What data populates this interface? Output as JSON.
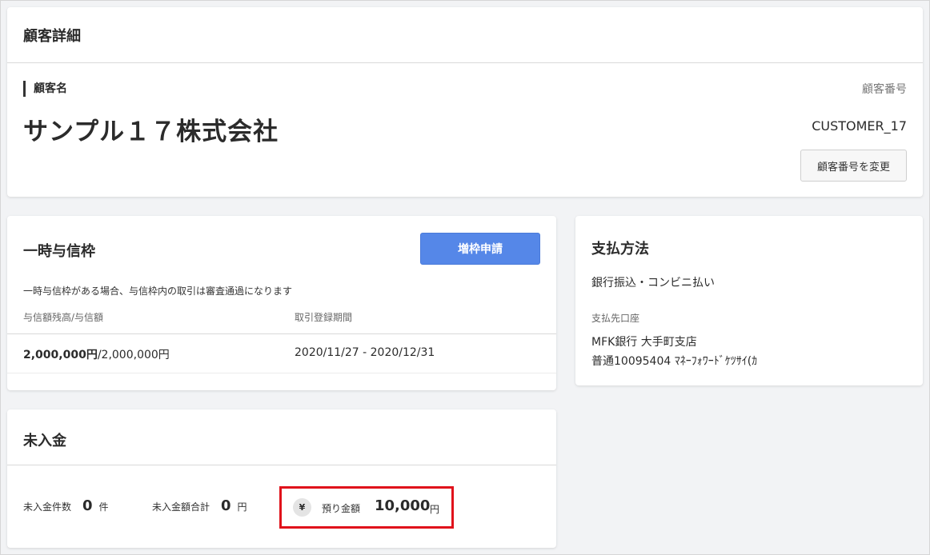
{
  "customer": {
    "title": "顧客詳細",
    "name_label": "顧客名",
    "name": "サンプル１７株式会社",
    "number_label": "顧客番号",
    "number": "CUSTOMER_17",
    "change_button": "顧客番号を変更"
  },
  "credit": {
    "title": "一時与信枠",
    "apply_button": "増枠申請",
    "note": "一時与信枠がある場合、与信枠内の取引は審査通過になります",
    "col_balance_label": "与信額残高/与信額",
    "col_period_label": "取引登録期間",
    "balance_bold": "2,000,000円",
    "balance_rest": "/2,000,000円",
    "period": "2020/11/27 - 2020/12/31"
  },
  "payment": {
    "title": "支払方法",
    "method": "銀行振込・コンビニ払い",
    "dest_label": "支払先口座",
    "bank": "MFK銀行 大手町支店",
    "account": "普通10095404 ﾏﾈｰﾌｫﾜｰﾄﾞｹﾂｻｲ(ｶ"
  },
  "unpaid": {
    "title": "未入金",
    "count_label": "未入金件数",
    "count_value": "0",
    "count_unit": "件",
    "total_label": "未入金額合計",
    "total_value": "0",
    "total_unit": "円",
    "deposit_icon": "yen-icon",
    "deposit_icon_glyph": "¥",
    "deposit_label": "預り金額",
    "deposit_value": "10,000",
    "deposit_unit": "円",
    "highlight_color": "#e0121b"
  }
}
